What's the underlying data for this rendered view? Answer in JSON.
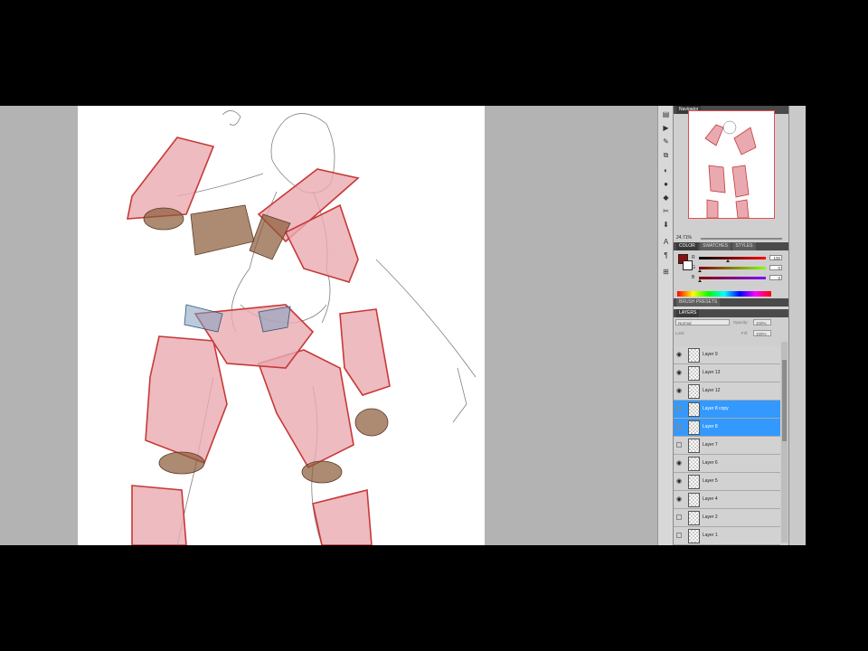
{
  "navigator": {
    "tab": "Navigator",
    "zoom": "24.71%"
  },
  "color": {
    "tabs": [
      "COLOR",
      "SWATCHES",
      "STYLES"
    ],
    "fg_hex": "#8b0e0e",
    "bg_hex": "#ffffff",
    "r": {
      "label": "R",
      "value": "132"
    },
    "g": {
      "label": "G",
      "value": "0"
    },
    "b": {
      "label": "B",
      "value": "0"
    }
  },
  "brush_presets": {
    "tab": "BRUSH PRESETS"
  },
  "layers": {
    "tab": "LAYERS",
    "blend_mode": "Normal",
    "opacity_label": "Opacity:",
    "opacity_value": "100%",
    "lock_label": "Lock:",
    "fill_label": "Fill:",
    "fill_value": "100%",
    "items": [
      {
        "name": "Layer 9",
        "visible": true,
        "selected": false
      },
      {
        "name": "Layer 13",
        "visible": true,
        "selected": false
      },
      {
        "name": "Layer 12",
        "visible": true,
        "selected": false
      },
      {
        "name": "Layer 8 copy",
        "visible": false,
        "selected": true
      },
      {
        "name": "Layer 8",
        "visible": false,
        "selected": true
      },
      {
        "name": "Layer 7",
        "visible": false,
        "selected": false
      },
      {
        "name": "Layer 6",
        "visible": true,
        "selected": false
      },
      {
        "name": "Layer 5",
        "visible": true,
        "selected": false
      },
      {
        "name": "Layer 4",
        "visible": true,
        "selected": false
      },
      {
        "name": "Layer 2",
        "visible": false,
        "selected": false
      },
      {
        "name": "Layer 1",
        "visible": false,
        "selected": false
      }
    ]
  },
  "tool_icons": [
    "history-icon",
    "actions-icon",
    "brush-icon",
    "clone-source-icon",
    "adjustments-icon",
    "masks-icon",
    "styles-icon",
    "3d-icon",
    "character-icon",
    "paragraph-icon",
    "info-icon"
  ],
  "colors": {
    "armor": "#c83838",
    "armor_fill": "#e8aab0",
    "leather": "#8a5a38",
    "sketch": "#555555"
  }
}
